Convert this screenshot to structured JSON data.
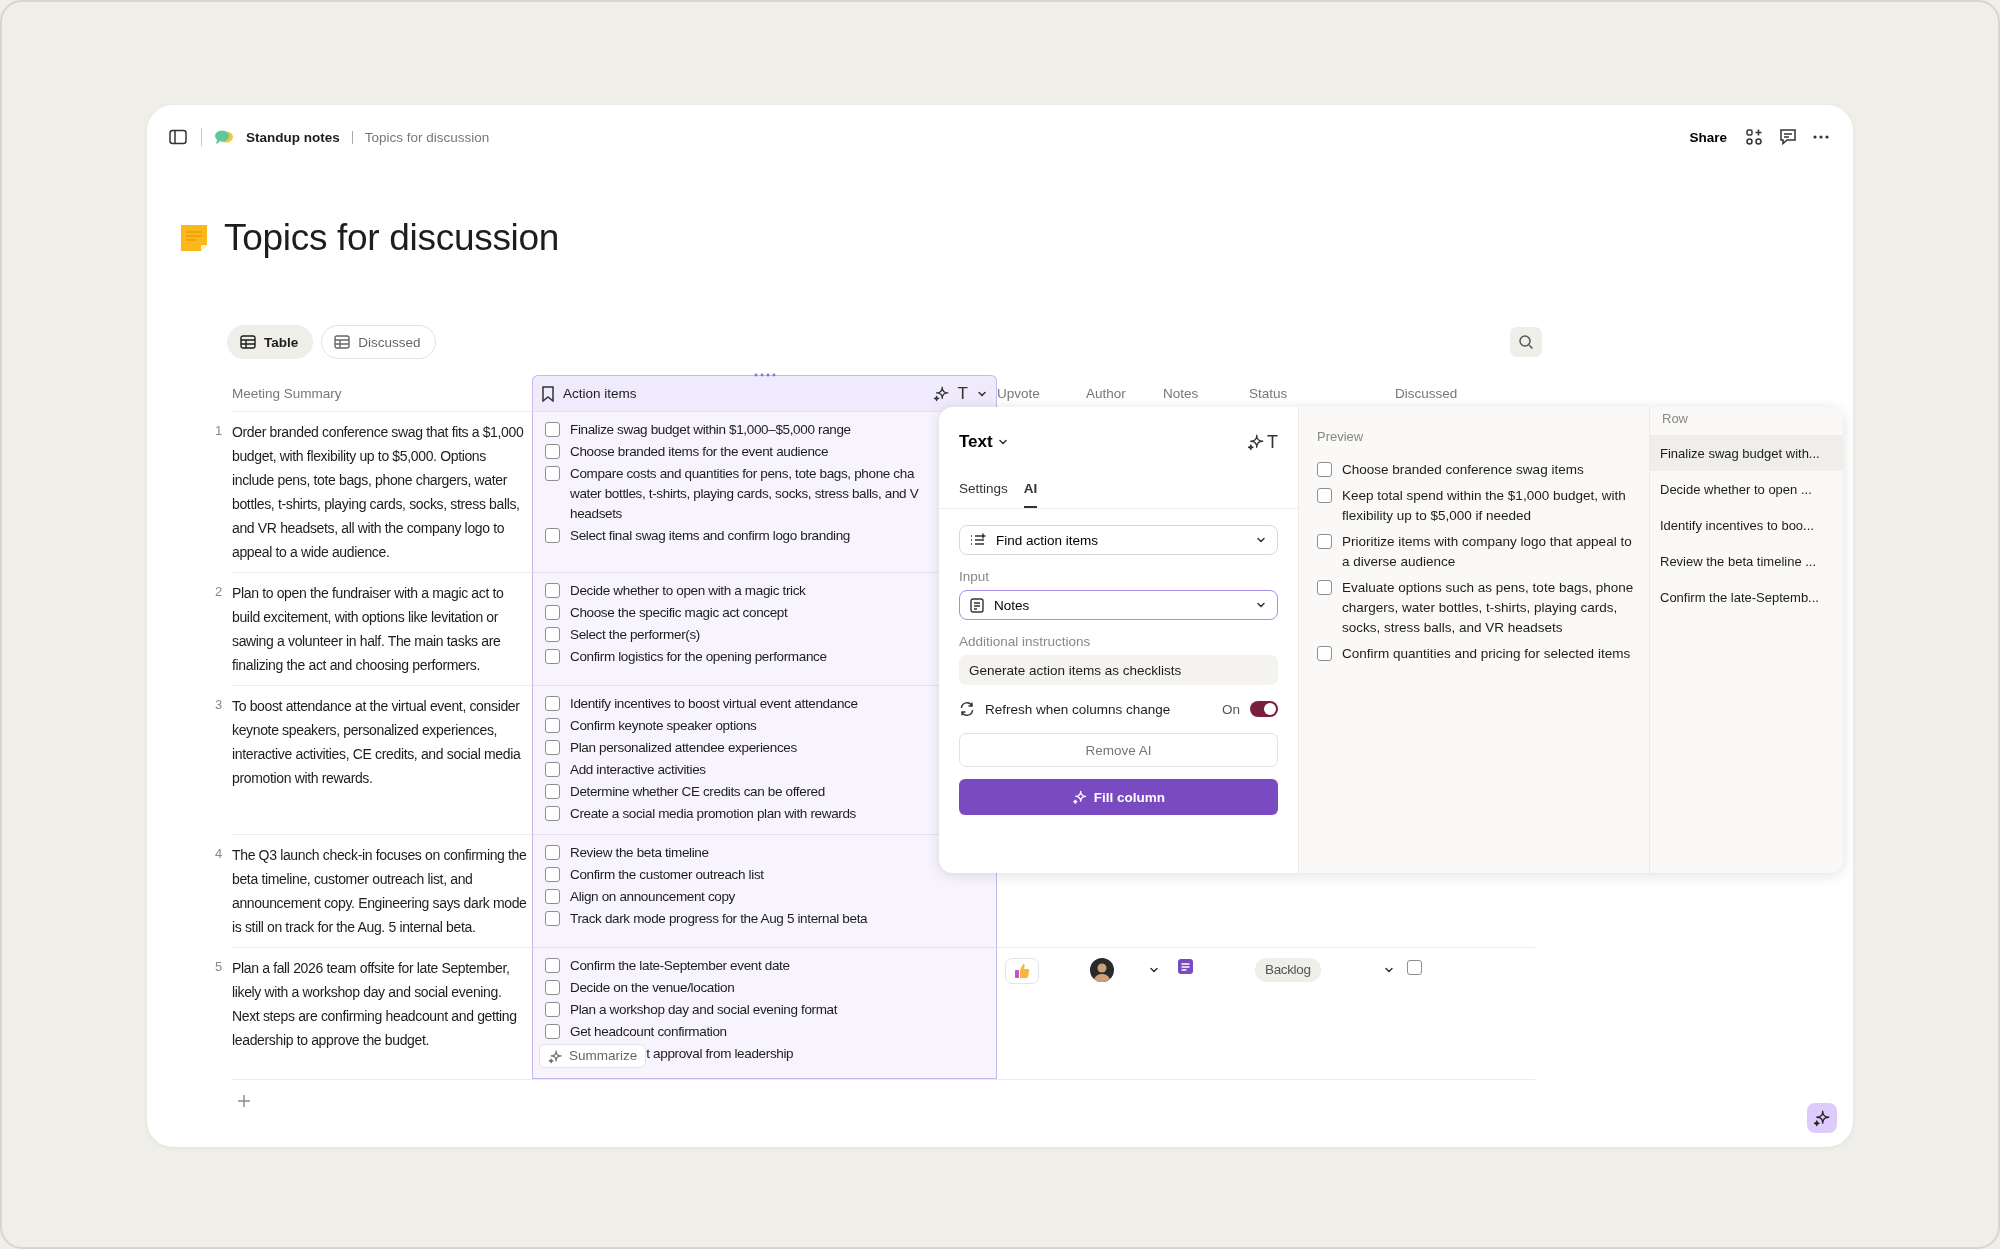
{
  "breadcrumb": {
    "parent": "Standup notes",
    "current": "Topics for discussion"
  },
  "header_actions": {
    "share": "Share"
  },
  "page": {
    "title": "Topics for discussion"
  },
  "views": [
    {
      "label": "Table",
      "selected": true
    },
    {
      "label": "Discussed",
      "selected": false
    }
  ],
  "table": {
    "columns": [
      {
        "label": "Meeting Summary",
        "kind": "text"
      },
      {
        "label": "Action items",
        "kind": "ai",
        "type_icon": "T"
      },
      {
        "label": "Upvote",
        "kind": "plain"
      },
      {
        "label": "Author",
        "kind": "plain"
      },
      {
        "label": "Notes",
        "kind": "plain"
      },
      {
        "label": "Status",
        "kind": "plain"
      },
      {
        "label": "Discussed",
        "kind": "plain"
      }
    ],
    "rows": [
      {
        "number": "1",
        "summary": "Order branded conference swag that fits a $1,000 budget, with flexibility up to $5,000. Options include pens, tote bags, phone chargers, water bottles, t-shirts, playing cards, socks, stress balls, and VR headsets, all with the company logo to appeal to a wide audience.",
        "action_items": [
          {
            "kind": "check",
            "text": "Finalize swag budget within $1,000–$5,000 range",
            "checked": false
          },
          {
            "kind": "check",
            "text": "Choose branded items for the event audience",
            "checked": false
          },
          {
            "kind": "check",
            "text": "Compare costs and quantities for pens, tote bags, phone cha water bottles, t-shirts, playing cards, socks, stress balls, and V headsets",
            "checked": false
          },
          {
            "kind": "check",
            "text": "Select final swag items and confirm logo branding",
            "checked": false
          }
        ]
      },
      {
        "number": "2",
        "summary": "Plan to open the fundraiser with a magic act to build excitement, with options like levitation or sawing a volunteer in half. The main tasks are finalizing the act and choosing performers.",
        "action_items": [
          {
            "kind": "check",
            "text": "Decide whether to open with a magic trick",
            "checked": false
          },
          {
            "kind": "check",
            "text": "Choose the specific magic act concept",
            "checked": false
          },
          {
            "kind": "check",
            "text": "Select the performer(s)",
            "checked": false
          },
          {
            "kind": "check",
            "text": "Confirm logistics for the opening performance",
            "checked": false
          }
        ]
      },
      {
        "number": "3",
        "summary": "To boost attendance at the virtual event, consider keynote speakers, personalized experiences, interactive activities, CE credits, and social media promotion with rewards.",
        "action_items": [
          {
            "kind": "check",
            "text": "Identify incentives to boost virtual event attendance",
            "checked": false
          },
          {
            "kind": "check",
            "text": "Confirm keynote speaker options",
            "checked": false
          },
          {
            "kind": "check",
            "text": "Plan personalized attendee experiences",
            "checked": false
          },
          {
            "kind": "check",
            "text": "Add interactive activities",
            "checked": false
          },
          {
            "kind": "check",
            "text": "Determine whether CE credits can be offered",
            "checked": false
          },
          {
            "kind": "check",
            "text": "Create a social media promotion plan with rewards",
            "checked": false
          }
        ]
      },
      {
        "number": "4",
        "summary": "The Q3 launch check-in focuses on confirming the beta timeline, customer outreach list, and announcement copy. Engineering says dark mode is still on track for the Aug. 5 internal beta.",
        "action_items": [
          {
            "kind": "check",
            "text": "Review the beta timeline",
            "checked": false
          },
          {
            "kind": "check",
            "text": "Confirm the customer outreach list",
            "checked": false
          },
          {
            "kind": "check",
            "text": "Align on announcement copy",
            "checked": false
          },
          {
            "kind": "check",
            "text": "Track dark mode progress for the Aug 5 internal beta",
            "checked": false
          }
        ]
      },
      {
        "number": "5",
        "summary": "Plan a fall 2026 team offsite for late September, likely with a workshop day and social evening. Next steps are confirming headcount and getting leadership to approve the budget.",
        "action_items": [
          {
            "kind": "check",
            "text": "Confirm the late-September event date",
            "checked": false
          },
          {
            "kind": "check",
            "text": "Decide on the venue/location",
            "checked": false
          },
          {
            "kind": "check",
            "text": "Plan a workshop day and social evening format",
            "checked": false
          },
          {
            "kind": "check",
            "text": "Get headcount confirmation",
            "checked": false
          },
          {
            "kind": "covered",
            "cover_label": "Summarize",
            "text": "t approval from leadership"
          }
        ],
        "status": "Backlog",
        "discussed": false
      }
    ]
  },
  "popup": {
    "type_label": "Text",
    "type_icon": "T",
    "tabs": [
      {
        "label": "Settings",
        "selected": false
      },
      {
        "label": "AI",
        "selected": true
      }
    ],
    "action": "Find action items",
    "input_label": "Input",
    "input_value": "Notes",
    "instructions_label": "Additional instructions",
    "instructions_value": "Generate action items as checklists",
    "refresh": {
      "label": "Refresh when columns change",
      "state_label": "On",
      "on": true
    },
    "remove_button": "Remove AI",
    "fill_button": "Fill column",
    "preview": {
      "label": "Preview",
      "items": [
        {
          "text": "Choose branded conference swag items",
          "checked": false
        },
        {
          "text": "Keep total spend within the $1,000 budget, with flexibility up to $5,000 if needed",
          "checked": false
        },
        {
          "text": "Prioritize items with company logo that appeal to a diverse audience",
          "checked": false
        },
        {
          "text": "Evaluate options such as pens, tote bags, phone chargers, water bottles, t-shirts, playing cards, socks, stress balls, and VR headsets",
          "checked": false
        },
        {
          "text": "Confirm quantities and pricing for selected items",
          "checked": false
        }
      ]
    },
    "rows_panel": {
      "label": "Row",
      "items": [
        {
          "text": "Finalize swag budget with...",
          "selected": true
        },
        {
          "text": "Decide whether to open ...",
          "selected": false
        },
        {
          "text": "Identify incentives to boo...",
          "selected": false
        },
        {
          "text": "Review the beta timeline ...",
          "selected": false
        },
        {
          "text": "Confirm the late-Septemb...",
          "selected": false
        }
      ]
    }
  }
}
